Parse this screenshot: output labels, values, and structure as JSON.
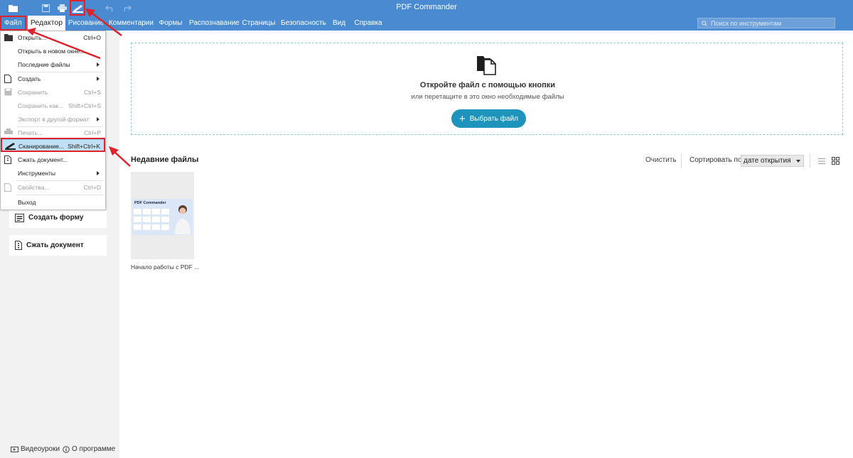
{
  "app": {
    "title": "PDF Commander"
  },
  "tabs": {
    "file": "Файл",
    "items": [
      "Редактор",
      "Рисование",
      "Комментарии",
      "Формы",
      "Распознавание",
      "Страницы",
      "Безопасность",
      "Вид",
      "Справка"
    ]
  },
  "search": {
    "placeholder": "Поиск по инструментам"
  },
  "file_menu": {
    "open": {
      "label": "Открыть...",
      "shortcut": "Ctrl+O"
    },
    "open_new_window": {
      "label": "Открыть в новом окне..."
    },
    "recent_files": {
      "label": "Последние файлы"
    },
    "create": {
      "label": "Создать"
    },
    "save": {
      "label": "Сохранить",
      "shortcut": "Ctrl+S"
    },
    "save_as": {
      "label": "Сохранить как...",
      "shortcut": "Shift+Ctrl+S"
    },
    "export": {
      "label": "Экспорт в другой формат"
    },
    "print": {
      "label": "Печать...",
      "shortcut": "Ctrl+P"
    },
    "scan": {
      "label": "Сканирование...",
      "shortcut": "Shift+Ctrl+K"
    },
    "compress": {
      "label": "Сжать документ..."
    },
    "tools": {
      "label": "Инструменты"
    },
    "properties": {
      "label": "Свойства...",
      "shortcut": "Ctrl+D"
    },
    "exit": {
      "label": "Выход"
    }
  },
  "side_actions": {
    "create_form": "Создать форму",
    "compress_doc": "Сжать документ"
  },
  "footer": {
    "videos": "Видеоуроки",
    "about": "О программе"
  },
  "dropzone": {
    "title": "Откройте файл с помощью кнопки",
    "subtitle": "или перетащите в это окно необходимые файлы",
    "button": "Выбрать файл"
  },
  "recent": {
    "title": "Недавние файлы",
    "clear": "Очистить",
    "sort_label": "Сортировать по:",
    "sort_value": "дате открытия",
    "files": [
      {
        "name": "Начало работы с PDF ...",
        "thumb_title": "PDF Commander"
      }
    ]
  },
  "colors": {
    "titlebar": "#4a8ad1",
    "accent_button": "#1e94bd",
    "highlight_red": "#e0222a",
    "menu_highlight": "#bfe0f7"
  }
}
